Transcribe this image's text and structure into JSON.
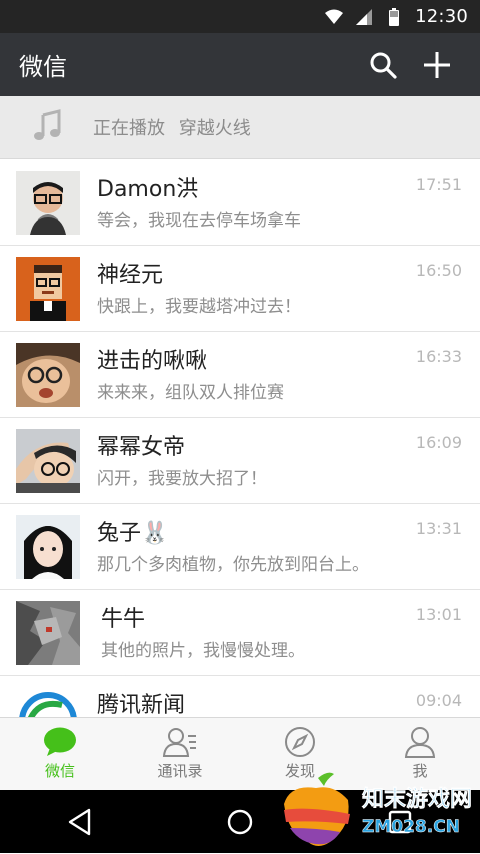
{
  "status_bar": {
    "time": "12:30",
    "icons": [
      "wifi-icon",
      "signal-icon",
      "battery-icon"
    ]
  },
  "top_bar": {
    "title": "微信",
    "icons": [
      "search-icon",
      "plus-icon"
    ]
  },
  "now_playing": {
    "label": "正在播放",
    "song": "穿越火线",
    "icon": "music-note-icon"
  },
  "chats": [
    {
      "name": "Damon洪",
      "time": "17:51",
      "preview": "等会，我现在去停车场拿车"
    },
    {
      "name": "神经元",
      "time": "16:50",
      "preview": "快跟上，我要越塔冲过去！"
    },
    {
      "name": "进击的啾啾",
      "time": "16:33",
      "preview": "来来来，组队双人排位赛"
    },
    {
      "name": "幂幂女帝",
      "time": "16:09",
      "preview": "闪开，我要放大招了！"
    },
    {
      "name": "兔子🐰",
      "time": "13:31",
      "preview": "那几个多肉植物，你先放到阳台上。"
    },
    {
      "name": "牛牛",
      "time": "13:01",
      "preview": "其他的照片，我慢慢处理。"
    },
    {
      "name": "腾讯新闻",
      "time": "09:04",
      "preview": ""
    }
  ],
  "tabs": [
    {
      "label": "微信",
      "icon": "chat-bubble-icon",
      "active": true
    },
    {
      "label": "通讯录",
      "icon": "contacts-icon",
      "active": false
    },
    {
      "label": "发现",
      "icon": "compass-icon",
      "active": false
    },
    {
      "label": "我",
      "icon": "person-icon",
      "active": false
    }
  ],
  "nav_bar": {
    "icons": [
      "back-icon",
      "home-icon",
      "recents-icon"
    ]
  },
  "watermark": {
    "text_line1": "知末游戏网",
    "text_line2": "ZM028.CN"
  },
  "colors": {
    "accent": "#45c01a",
    "header_bg": "#333539",
    "status_bg": "#252525"
  }
}
